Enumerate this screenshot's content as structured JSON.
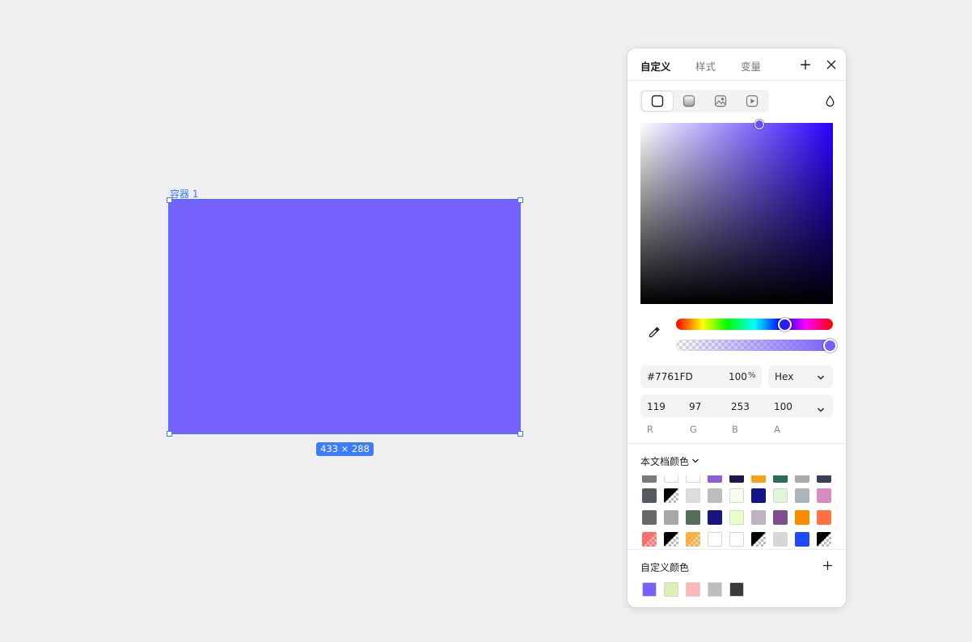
{
  "canvas": {
    "frame_label": "容器 1",
    "frame_color": "#7761FD",
    "selection_color": "#3D7BFF",
    "size_badge": "433 × 288"
  },
  "panel": {
    "tabs": [
      {
        "label": "自定义",
        "active": true
      },
      {
        "label": "样式",
        "active": false
      },
      {
        "label": "变量",
        "active": false
      }
    ],
    "header_icons": [
      "plus-icon",
      "close-icon"
    ],
    "fill_types": [
      "solid-fill-icon",
      "gradient-fill-icon",
      "image-fill-icon",
      "video-fill-icon"
    ],
    "color": {
      "hex": "#7761FD",
      "opacity": "100",
      "opacity_unit": "%",
      "format": "Hex",
      "r": "119",
      "g": "97",
      "b": "253",
      "a": "100",
      "channel_labels": {
        "r": "R",
        "g": "G",
        "b": "B",
        "a": "A"
      }
    },
    "document_colors": {
      "title": "本文档颜色",
      "rows": [
        [
          "#7a7a7a",
          "#ffffff",
          "#ffffff",
          "#8d5fd3",
          "#1b1b4b",
          "#f5a31a",
          "#2e6a5a",
          "#aaaaaa",
          "#3b3f5c"
        ],
        [
          "#555a60",
          "split-black",
          "#dcdcdc",
          "#bdbdbd",
          "#f4fff0",
          "#14148a",
          "#def7d8",
          "#aeb4bc",
          "#d68cc0"
        ],
        [
          "#686868",
          "#a8a8a8",
          "#556b5c",
          "#15157f",
          "#e9ffc8",
          "#bcb3c4",
          "#7d4f8e",
          "#ff8a00",
          "#ff7043"
        ],
        [
          "checker-red",
          "split-black",
          "checker-orange",
          "#ffffff",
          "#ffffff",
          "split-black",
          "#d6d6d6",
          "#1f49ff",
          "split-black"
        ]
      ]
    },
    "custom_colors": {
      "title": "自定义颜色",
      "swatches": [
        "#7761FD",
        "#DCF0B4",
        "#FFB8B8",
        "#BDBDBD",
        "#3A3A3A"
      ]
    }
  }
}
